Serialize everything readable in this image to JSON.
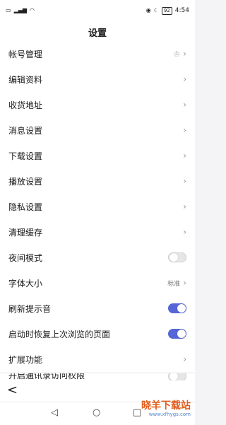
{
  "status_bar": {
    "left_icons": [
      "sim-icon",
      "signal-icon",
      "wifi-icon"
    ],
    "right_icons": [
      "eye-icon",
      "moon-icon"
    ],
    "battery": "92",
    "time": "4:54"
  },
  "header": {
    "title": "设置"
  },
  "groups": [
    {
      "items": [
        {
          "label": "帐号管理",
          "right": "chevron",
          "extra_icon": "crown-icon"
        },
        {
          "label": "编辑资料",
          "right": "chevron"
        },
        {
          "label": "收货地址",
          "right": "chevron"
        }
      ]
    },
    {
      "items": [
        {
          "label": "消息设置",
          "right": "chevron"
        },
        {
          "label": "下载设置",
          "right": "chevron"
        },
        {
          "label": "播放设置",
          "right": "chevron"
        },
        {
          "label": "隐私设置",
          "right": "chevron"
        },
        {
          "label": "清理缓存",
          "right": "chevron"
        },
        {
          "label": "夜间模式",
          "right": "toggle",
          "toggle_on": false
        },
        {
          "label": "字体大小",
          "right": "chevron",
          "value": "标准"
        },
        {
          "label": "刷新提示音",
          "right": "toggle",
          "toggle_on": true
        },
        {
          "label": "启动时恢复上次浏览的页面",
          "right": "toggle",
          "toggle_on": true
        },
        {
          "label": "扩展功能",
          "right": "chevron"
        }
      ]
    }
  ],
  "partial_item": {
    "label": "开启通讯录访问权限",
    "toggle_on": false
  },
  "back": {
    "icon": "back-arrow-icon"
  },
  "nav": [
    "back-triangle-icon",
    "home-circle-icon",
    "recent-square-icon"
  ],
  "watermark": {
    "text": "晓羊下载站",
    "url": "www.xfhygs.com"
  },
  "colors": {
    "accent": "#5566d6",
    "background": "#f4f4f6",
    "watermark": "#e25c1a"
  }
}
